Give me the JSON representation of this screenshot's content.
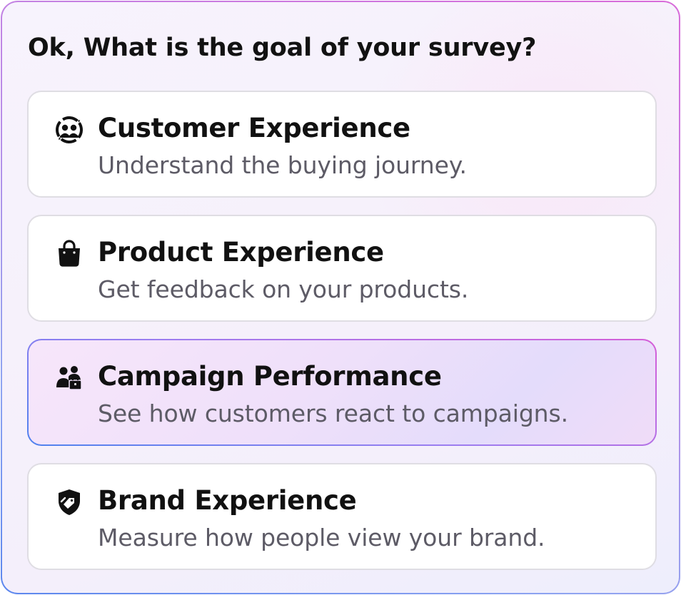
{
  "survey": {
    "question": "Ok, What is the goal of your survey?",
    "options": [
      {
        "title": "Customer Experience",
        "description": "Understand the buying journey.",
        "icon": "customer-experience-icon",
        "selected": false
      },
      {
        "title": "Product Experience",
        "description": "Get feedback on your products.",
        "icon": "shopping-bag-icon",
        "selected": false
      },
      {
        "title": "Campaign Performance",
        "description": "See how customers react to campaigns.",
        "icon": "people-briefcase-icon",
        "selected": true
      },
      {
        "title": "Brand Experience",
        "description": "Measure how people view your brand.",
        "icon": "shield-tag-icon",
        "selected": false
      }
    ]
  },
  "colors": {
    "text_primary": "#111111",
    "text_secondary": "#5d5b66",
    "card_border": "#dfdde3",
    "selected_gradient_start": "#4f82ee",
    "selected_gradient_end": "#d55ed8"
  }
}
